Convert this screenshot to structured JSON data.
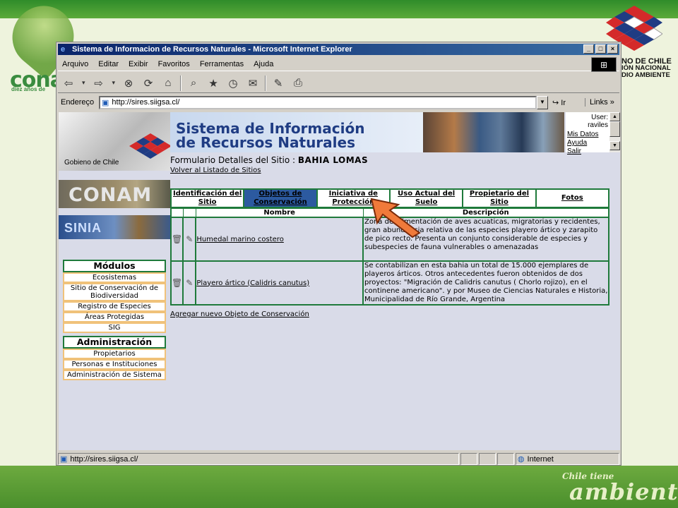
{
  "slide": {
    "conama_logo": "conam",
    "conama_tagline": "diez años de",
    "gov_line1": "NO DE CHILE",
    "gov_line2": "IÓN NACIONAL",
    "gov_line3": "DIO AMBIENTE",
    "brand_line1": "Chile tiene",
    "brand_line2": "ambiente"
  },
  "window": {
    "title": "Sistema de Informacion de Recursos Naturales - Microsoft Internet Explorer",
    "controls": [
      "_",
      "□",
      "×"
    ]
  },
  "menubar": [
    "Arquivo",
    "Editar",
    "Exibir",
    "Favoritos",
    "Ferramentas",
    "Ajuda"
  ],
  "toolbar": {
    "icons": [
      "back-icon",
      "forward-icon",
      "stop-icon",
      "refresh-icon",
      "home-icon",
      "search-icon",
      "favorites-icon",
      "history-icon",
      "mail-icon",
      "edit-icon",
      "print-icon"
    ]
  },
  "address": {
    "label": "Endereço",
    "url": "http://sires.siigsa.cl/",
    "go": "Ir",
    "links": "Links »"
  },
  "banner": {
    "gobierno": "Gobieno de Chile",
    "title_line1": "Sistema de Información",
    "title_line2": "de Recursos Naturales",
    "user_label": "User:",
    "user_name": "raviles",
    "mis_datos": "Mis Datos",
    "ayuda": "Ayuda",
    "salir": "Salir"
  },
  "side": {
    "conama": "CONAM",
    "sinia": "SINIA",
    "modulos_head": "Módulos",
    "modulos": [
      "Ecosistemas",
      "Sitio de Conservación de Biodiversidad",
      "Registro de Especies",
      "Áreas Protegidas",
      "SIG"
    ],
    "admin_head": "Administración",
    "admin": [
      "Propietarios",
      "Personas e Instituciones",
      "Administración de Sistema"
    ]
  },
  "form": {
    "title_prefix": "Formulario Detalles del Sitio : ",
    "site_name": "BAHIA LOMAS",
    "back_link": "Volver al Listado de Sitios",
    "tabs": [
      "Identificación del Sitio",
      "Objetos de Conservación",
      "Iniciativa de Protección",
      "Uso Actual del Suelo",
      "Propietario del Sitio",
      "Fotos"
    ],
    "active_tab": "Objetos de Conservación",
    "columns": [
      "Nombre",
      "Descripción"
    ],
    "rows": [
      {
        "nombre": "Humedal marino costero",
        "descripcion": "Zona de alimentación de aves acuaticas, migratorias y recidentes, gran abundancia relativa de las especies playero ártico y zarapito de pico recto. Presenta un conjunto considerable de especies y subespecies de fauna vulnerables o amenazadas"
      },
      {
        "nombre": "Playero ártico (Calidris canutus)",
        "descripcion": "Se contabilizan en esta bahia un total de 15.000 ejemplares de playeros árticos. Otros antecedentes fueron obtenidos de dos proyectos: \"Migración de Calidris canutus ( Chorlo rojizo), en el continene americano\". y por Museo de Ciencias Naturales e Historia, Municipalidad de Río Grande, Argentina"
      }
    ],
    "add_link": "Agregar nuevo Objeto de Conservación"
  },
  "status": {
    "url": "http://sires.siigsa.cl/",
    "zone": "Internet"
  },
  "colors": {
    "title_bar": "#0a246a",
    "accent_green": "#1f7a3b",
    "active_tab": "#2c5aa0",
    "arrow": "#f07a3a"
  }
}
